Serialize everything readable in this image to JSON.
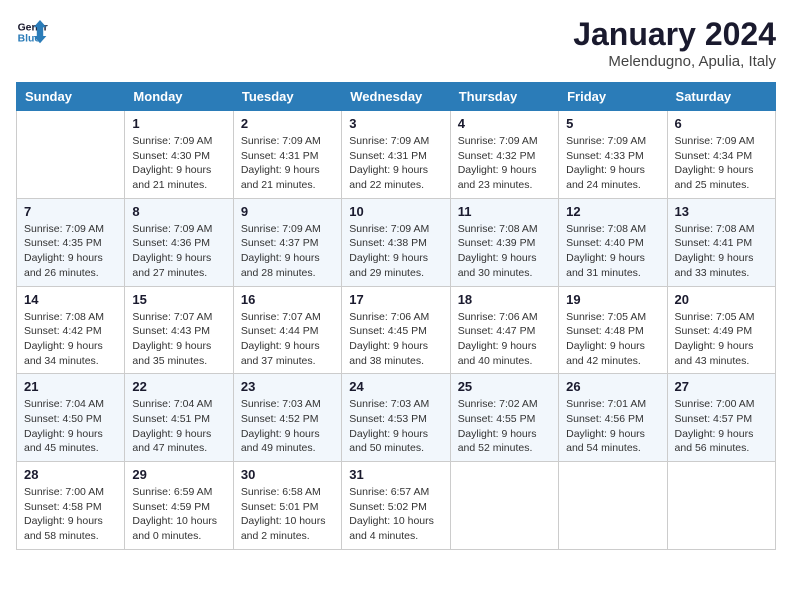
{
  "logo": {
    "text_general": "General",
    "text_blue": "Blue"
  },
  "header": {
    "title": "January 2024",
    "subtitle": "Melendugno, Apulia, Italy"
  },
  "weekdays": [
    "Sunday",
    "Monday",
    "Tuesday",
    "Wednesday",
    "Thursday",
    "Friday",
    "Saturday"
  ],
  "weeks": [
    [
      {
        "day": "",
        "info": ""
      },
      {
        "day": "1",
        "info": "Sunrise: 7:09 AM\nSunset: 4:30 PM\nDaylight: 9 hours\nand 21 minutes."
      },
      {
        "day": "2",
        "info": "Sunrise: 7:09 AM\nSunset: 4:31 PM\nDaylight: 9 hours\nand 21 minutes."
      },
      {
        "day": "3",
        "info": "Sunrise: 7:09 AM\nSunset: 4:31 PM\nDaylight: 9 hours\nand 22 minutes."
      },
      {
        "day": "4",
        "info": "Sunrise: 7:09 AM\nSunset: 4:32 PM\nDaylight: 9 hours\nand 23 minutes."
      },
      {
        "day": "5",
        "info": "Sunrise: 7:09 AM\nSunset: 4:33 PM\nDaylight: 9 hours\nand 24 minutes."
      },
      {
        "day": "6",
        "info": "Sunrise: 7:09 AM\nSunset: 4:34 PM\nDaylight: 9 hours\nand 25 minutes."
      }
    ],
    [
      {
        "day": "7",
        "info": ""
      },
      {
        "day": "8",
        "info": "Sunrise: 7:09 AM\nSunset: 4:36 PM\nDaylight: 9 hours\nand 27 minutes."
      },
      {
        "day": "9",
        "info": "Sunrise: 7:09 AM\nSunset: 4:37 PM\nDaylight: 9 hours\nand 28 minutes."
      },
      {
        "day": "10",
        "info": "Sunrise: 7:09 AM\nSunset: 4:38 PM\nDaylight: 9 hours\nand 29 minutes."
      },
      {
        "day": "11",
        "info": "Sunrise: 7:08 AM\nSunset: 4:39 PM\nDaylight: 9 hours\nand 30 minutes."
      },
      {
        "day": "12",
        "info": "Sunrise: 7:08 AM\nSunset: 4:40 PM\nDaylight: 9 hours\nand 31 minutes."
      },
      {
        "day": "13",
        "info": "Sunrise: 7:08 AM\nSunset: 4:41 PM\nDaylight: 9 hours\nand 33 minutes."
      }
    ],
    [
      {
        "day": "14",
        "info": ""
      },
      {
        "day": "15",
        "info": "Sunrise: 7:07 AM\nSunset: 4:43 PM\nDaylight: 9 hours\nand 35 minutes."
      },
      {
        "day": "16",
        "info": "Sunrise: 7:07 AM\nSunset: 4:44 PM\nDaylight: 9 hours\nand 37 minutes."
      },
      {
        "day": "17",
        "info": "Sunrise: 7:06 AM\nSunset: 4:45 PM\nDaylight: 9 hours\nand 38 minutes."
      },
      {
        "day": "18",
        "info": "Sunrise: 7:06 AM\nSunset: 4:47 PM\nDaylight: 9 hours\nand 40 minutes."
      },
      {
        "day": "19",
        "info": "Sunrise: 7:05 AM\nSunset: 4:48 PM\nDaylight: 9 hours\nand 42 minutes."
      },
      {
        "day": "20",
        "info": "Sunrise: 7:05 AM\nSunset: 4:49 PM\nDaylight: 9 hours\nand 43 minutes."
      }
    ],
    [
      {
        "day": "21",
        "info": ""
      },
      {
        "day": "22",
        "info": "Sunrise: 7:04 AM\nSunset: 4:51 PM\nDaylight: 9 hours\nand 47 minutes."
      },
      {
        "day": "23",
        "info": "Sunrise: 7:03 AM\nSunset: 4:52 PM\nDaylight: 9 hours\nand 49 minutes."
      },
      {
        "day": "24",
        "info": "Sunrise: 7:03 AM\nSunset: 4:53 PM\nDaylight: 9 hours\nand 50 minutes."
      },
      {
        "day": "25",
        "info": "Sunrise: 7:02 AM\nSunset: 4:55 PM\nDaylight: 9 hours\nand 52 minutes."
      },
      {
        "day": "26",
        "info": "Sunrise: 7:01 AM\nSunset: 4:56 PM\nDaylight: 9 hours\nand 54 minutes."
      },
      {
        "day": "27",
        "info": "Sunrise: 7:00 AM\nSunset: 4:57 PM\nDaylight: 9 hours\nand 56 minutes."
      }
    ],
    [
      {
        "day": "28",
        "info": ""
      },
      {
        "day": "29",
        "info": "Sunrise: 6:59 AM\nSunset: 4:59 PM\nDaylight: 10 hours\nand 0 minutes."
      },
      {
        "day": "30",
        "info": "Sunrise: 6:58 AM\nSunset: 5:01 PM\nDaylight: 10 hours\nand 2 minutes."
      },
      {
        "day": "31",
        "info": "Sunrise: 6:57 AM\nSunset: 5:02 PM\nDaylight: 10 hours\nand 4 minutes."
      },
      {
        "day": "",
        "info": ""
      },
      {
        "day": "",
        "info": ""
      },
      {
        "day": "",
        "info": ""
      }
    ]
  ],
  "week1_sunday": "Sunrise: 7:09 AM\nSunset: 4:35 PM\nDaylight: 9 hours\nand 26 minutes.",
  "week2_sunday": "Sunrise: 7:09 AM\nSunset: 4:35 PM\nDaylight: 9 hours\nand 26 minutes.",
  "week3_sunday": "Sunrise: 7:08 AM\nSunset: 4:42 PM\nDaylight: 9 hours\nand 34 minutes.",
  "week4_sunday": "Sunrise: 7:04 AM\nSunset: 4:50 PM\nDaylight: 9 hours\nand 45 minutes.",
  "week5_sunday": "Sunrise: 7:00 AM\nSunset: 4:58 PM\nDaylight: 9 hours\nand 58 minutes."
}
